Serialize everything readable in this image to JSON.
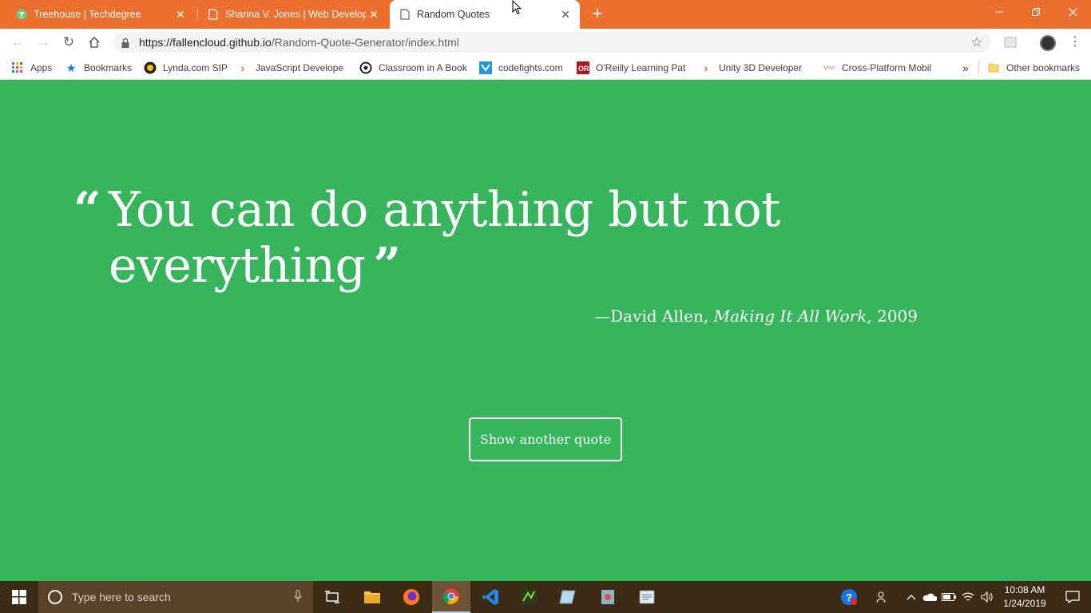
{
  "browser": {
    "tabs": [
      {
        "title": "Treehouse | Techdegree",
        "icon": "treehouse-icon",
        "active": false
      },
      {
        "title": "Sharina V. Jones | Web Developer",
        "icon": "page-icon",
        "active": false
      },
      {
        "title": "Random Quotes",
        "icon": "page-icon",
        "active": true
      }
    ],
    "new_tab_label": "+",
    "url_host": "https://fallencloud.github.io",
    "url_path": "/Random-Quote-Generator/index.html",
    "bookmarks": [
      {
        "label": "Apps",
        "icon": "apps-grid-icon"
      },
      {
        "label": "Bookmarks",
        "icon": "star-icon"
      },
      {
        "label": "Lynda.com SIP",
        "icon": "lynda-icon"
      },
      {
        "label": "JavaScript Developer",
        "icon": "treehouse-chevron-icon"
      },
      {
        "label": "Classroom in A Book",
        "icon": "classroom-icon"
      },
      {
        "label": "codefights.com",
        "icon": "codefights-icon"
      },
      {
        "label": "O'Reilly Learning Path",
        "icon": "oreilly-icon"
      },
      {
        "label": "Unity 3D Developer",
        "icon": "treehouse-chevron-icon"
      },
      {
        "label": "Cross-Platform Mobile",
        "icon": "cross-platform-icon"
      }
    ],
    "overflow_label": "»",
    "other_bookmarks_label": "Other bookmarks"
  },
  "quote": {
    "open_mark": "“",
    "text": "You can do anything but not everything",
    "close_mark": "”",
    "source_prefix": "—David Allen, ",
    "citation": "Making It All Work",
    "year": ", 2009",
    "button_label": "Show another quote"
  },
  "taskbar": {
    "search_placeholder": "Type here to search",
    "time": "10:08 AM",
    "date": "1/24/2019"
  },
  "colors": {
    "page_background": "#36b55c",
    "titlebar": "#ed6f2e",
    "taskbar": "#3c2b14"
  }
}
